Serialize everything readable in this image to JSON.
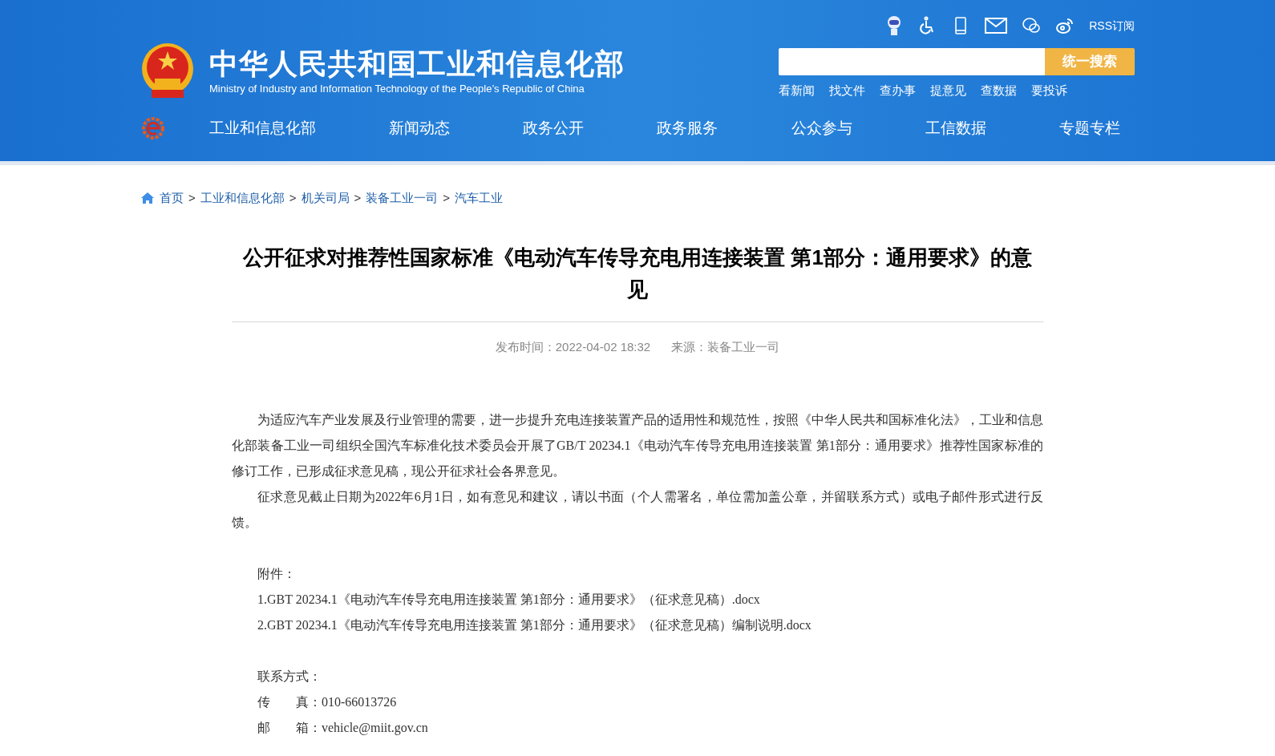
{
  "header": {
    "title": "中华人民共和国工业和信息化部",
    "subtitle": "Ministry of Industry and Information Technology of the People’s Republic of China",
    "rss": "RSS订阅",
    "search": {
      "button": "统一搜索"
    },
    "quick_links": [
      "看新闻",
      "找文件",
      "查办事",
      "提意见",
      "查数据",
      "要投诉"
    ],
    "nav": [
      "工业和信息化部",
      "新闻动态",
      "政务公开",
      "政务服务",
      "公众参与",
      "工信数据",
      "专题专栏"
    ]
  },
  "breadcrumb": {
    "separator": ">",
    "items": [
      "首页",
      "工业和信息化部",
      "机关司局",
      "装备工业一司",
      "汽车工业"
    ]
  },
  "article": {
    "title": "公开征求对推荐性国家标准《电动汽车传导充电用连接装置 第1部分：通用要求》的意见",
    "published": "发布时间：2022-04-02 18:32",
    "source": "来源：装备工业一司",
    "paragraphs": [
      "为适应汽车产业发展及行业管理的需要，进一步提升充电连接装置产品的适用性和规范性，按照《中华人民共和国标准化法》，工业和信息化部装备工业一司组织全国汽车标准化技术委员会开展了GB/T 20234.1《电动汽车传导充电用连接装置 第1部分：通用要求》推荐性国家标准的修订工作，已形成征求意见稿，现公开征求社会各界意见。",
      "征求意见截止日期为2022年6月1日，如有意见和建议，请以书面（个人需署名，单位需加盖公章，并留联系方式）或电子邮件形式进行反馈。"
    ],
    "attachments_label": "附件：",
    "attachments": [
      "1.GBT 20234.1《电动汽车传导充电用连接装置 第1部分：通用要求》（征求意见稿）.docx",
      "2.GBT 20234.1《电动汽车传导充电用连接装置 第1部分：通用要求》（征求意见稿）编制说明.docx"
    ],
    "contact_label": "联系方式：",
    "contacts": [
      "传　　真：010-66013726",
      "邮　　箱：vehicle@miit.gov.cn"
    ]
  }
}
